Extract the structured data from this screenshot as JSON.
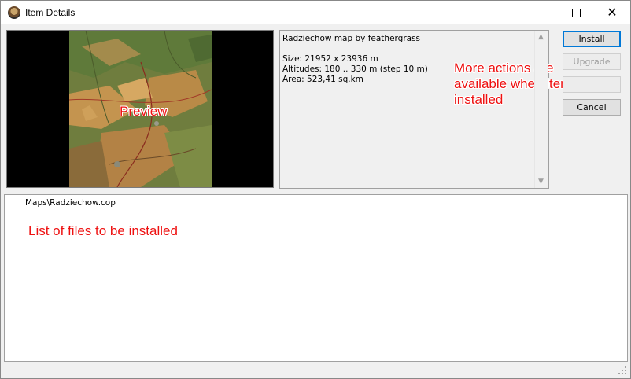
{
  "window": {
    "title": "Item Details",
    "icon": "app-icon",
    "controls": {
      "minimize": "minimize-icon",
      "maximize": "maximize-icon",
      "close": "close-icon"
    }
  },
  "preview": {
    "annotation": "Preview"
  },
  "info": {
    "line1": "Radziechow map by feathergrass",
    "line2": "Size: 21952 x 23936 m",
    "line3": "Altitudes: 180 .. 330 m (step 10 m)",
    "line4": "Area: 523,41 sq.km",
    "annotation_line1": "More actions are",
    "annotation_line2": "available when item is",
    "annotation_line3": "installed"
  },
  "actions": {
    "install": "Install",
    "upgrade": "Upgrade",
    "cancel": "Cancel"
  },
  "files": {
    "items": [
      "Maps\\Radziechow.cop"
    ],
    "annotation": "List of files to be installed"
  },
  "colors": {
    "annotation": "#ee1111",
    "focus_border": "#0078d7",
    "window_bg": "#f0f0f0"
  }
}
